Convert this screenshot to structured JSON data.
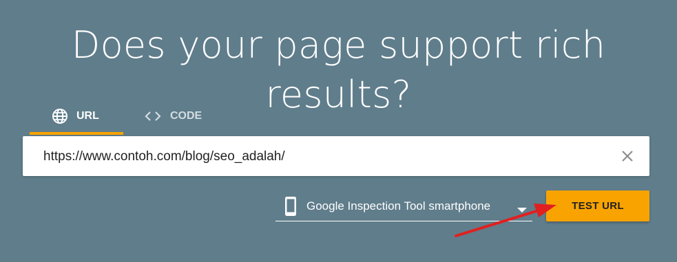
{
  "headline": "Does your page support rich results?",
  "tabs": [
    {
      "label": "URL",
      "icon": "globe-icon",
      "active": true
    },
    {
      "label": "CODE",
      "icon": "code-brackets-icon",
      "active": false
    }
  ],
  "url_input": {
    "value": "https://www.contoh.com/blog/seo_adalah/",
    "clear_icon": "close-icon"
  },
  "device_select": {
    "selected": "Google Inspection Tool smartphone",
    "icon": "smartphone-icon",
    "caret_icon": "dropdown-caret-icon"
  },
  "test_button": {
    "label": "TEST URL"
  },
  "colors": {
    "background": "#607d8b",
    "accent": "#f9a300",
    "annotation_arrow": "#e02020"
  }
}
